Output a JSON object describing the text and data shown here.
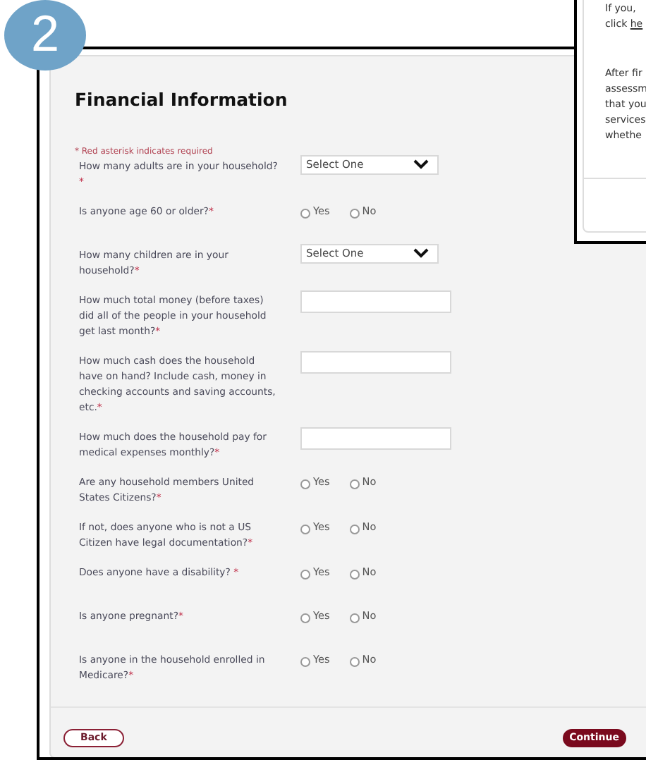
{
  "step_badge": "2",
  "side_panel": {
    "lines": [
      {
        "text": "If you,"
      },
      {
        "text": "click",
        "link_text": "he"
      },
      {
        "text": "After fir"
      },
      {
        "text": "assessm"
      },
      {
        "text": "that you"
      },
      {
        "text": "services"
      },
      {
        "text": "whethe"
      }
    ]
  },
  "form": {
    "title": "Financial Information",
    "required_note": "* Red asterisk indicates required",
    "questions": [
      {
        "kind": "select",
        "label": "How many adults are in your household?",
        "mark": "*",
        "value": "Select One"
      },
      {
        "kind": "radio",
        "label": "Is anyone age 60 or older?",
        "mark": "*",
        "options": [
          {
            "label": "Yes",
            "selected": false
          },
          {
            "label": "No",
            "selected": false
          }
        ]
      },
      {
        "kind": "select",
        "label": "How many children are in your household?",
        "mark": "*",
        "value": "Select One"
      },
      {
        "kind": "text",
        "label": "How much total money (before taxes) did all of the people in your household get last month?",
        "mark": "*"
      },
      {
        "kind": "text",
        "label": "How much cash does the household have on hand? Include cash, money in checking accounts and saving accounts, etc.",
        "mark": "*"
      },
      {
        "kind": "text",
        "label": "How much does the household pay for medical expenses monthly?",
        "mark": "*"
      },
      {
        "kind": "radio",
        "label": "Are any household members United States Citizens?",
        "mark": "*",
        "options": [
          {
            "label": "Yes",
            "selected": false
          },
          {
            "label": "No",
            "selected": false
          }
        ]
      },
      {
        "kind": "radio",
        "label": "If not, does anyone who is not a US Citizen have legal documentation?",
        "mark": "*",
        "options": [
          {
            "label": "Yes",
            "selected": false
          },
          {
            "label": "No",
            "selected": false
          }
        ]
      },
      {
        "kind": "radio",
        "label": "Does anyone have a disability? ",
        "mark": "*",
        "options": [
          {
            "label": "Yes",
            "selected": false
          },
          {
            "label": "No",
            "selected": false
          }
        ]
      },
      {
        "kind": "radio",
        "label": "Is anyone pregnant?",
        "mark": "*",
        "options": [
          {
            "label": "Yes",
            "selected": false
          },
          {
            "label": "No",
            "selected": false
          }
        ]
      },
      {
        "kind": "radio",
        "label": "Is anyone in the household enrolled in Medicare?",
        "mark": "*",
        "options": [
          {
            "label": "Yes",
            "selected": false
          },
          {
            "label": "No",
            "selected": false
          }
        ]
      }
    ],
    "buttons": [
      {
        "kind": "back",
        "label": "Back"
      },
      {
        "kind": "continue",
        "label": "Continue"
      }
    ]
  }
}
